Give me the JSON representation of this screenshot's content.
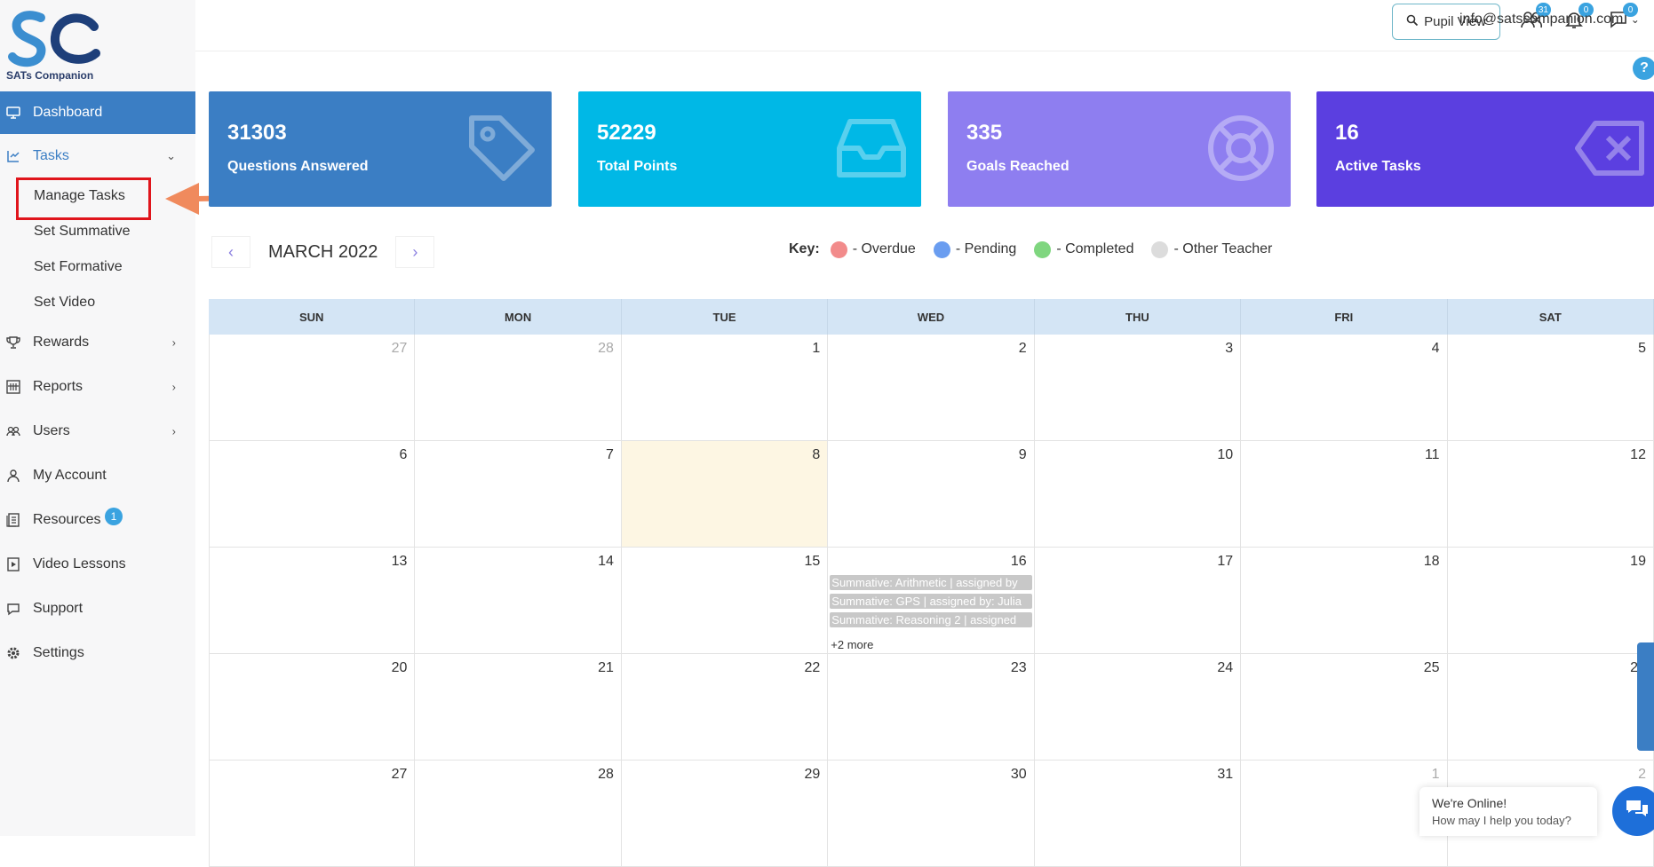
{
  "brand": {
    "logo_text": "SATs Companion"
  },
  "sidebar": {
    "items": [
      {
        "label": "Dashboard",
        "icon": "monitor-icon"
      },
      {
        "label": "Tasks",
        "icon": "tasks-icon"
      },
      {
        "label": "Rewards",
        "icon": "trophy-icon"
      },
      {
        "label": "Reports",
        "icon": "reports-icon"
      },
      {
        "label": "Users",
        "icon": "users-icon"
      },
      {
        "label": "My Account",
        "icon": "account-icon"
      },
      {
        "label": "Resources",
        "icon": "resources-icon",
        "badge": "1"
      },
      {
        "label": "Video Lessons",
        "icon": "video-icon"
      },
      {
        "label": "Support",
        "icon": "chat-icon"
      },
      {
        "label": "Settings",
        "icon": "gear-icon"
      }
    ],
    "tasks_sub": [
      "Manage Tasks",
      "Set Summative",
      "Set Formative",
      "Set Video"
    ]
  },
  "topbar": {
    "pupil_view": "Pupil View",
    "users_badge": "31",
    "bell_badge": "0",
    "messages_badge": "0",
    "email": "info@satscompanion.com",
    "help": "?"
  },
  "stats": [
    {
      "value": "31303",
      "label": "Questions Answered",
      "color": "#3b7ec4"
    },
    {
      "value": "52229",
      "label": "Total Points",
      "color": "#00b8e6"
    },
    {
      "value": "335",
      "label": "Goals Reached",
      "color": "#8e7ef0"
    },
    {
      "value": "16",
      "label": "Active Tasks",
      "color": "#5b3fe0"
    }
  ],
  "calendar": {
    "month": "MARCH 2022",
    "prev": "‹",
    "next": "›",
    "key_label": "Key:",
    "key": [
      {
        "label": "- Overdue",
        "color": "#f28b8b"
      },
      {
        "label": "- Pending",
        "color": "#6a9df0"
      },
      {
        "label": "- Completed",
        "color": "#7fd67f"
      },
      {
        "label": "- Other Teacher",
        "color": "#dcdcdc"
      }
    ],
    "weekdays": [
      "SUN",
      "MON",
      "TUE",
      "WED",
      "THU",
      "FRI",
      "SAT"
    ],
    "weeks": [
      [
        "27",
        "28",
        "1",
        "2",
        "3",
        "4",
        "5"
      ],
      [
        "6",
        "7",
        "8",
        "9",
        "10",
        "11",
        "12"
      ],
      [
        "13",
        "14",
        "15",
        "16",
        "17",
        "18",
        "19"
      ],
      [
        "20",
        "21",
        "22",
        "23",
        "24",
        "25",
        "26"
      ],
      [
        "27",
        "28",
        "29",
        "30",
        "31",
        "1",
        "2"
      ]
    ],
    "events": [
      "Summative: Arithmetic | assigned by",
      "Summative: GPS | assigned by: Julia",
      "Summative: Reasoning 2 | assigned"
    ],
    "more": "+2 more"
  },
  "chat": {
    "line1": "We're Online!",
    "line2": "How may I help you today?"
  }
}
